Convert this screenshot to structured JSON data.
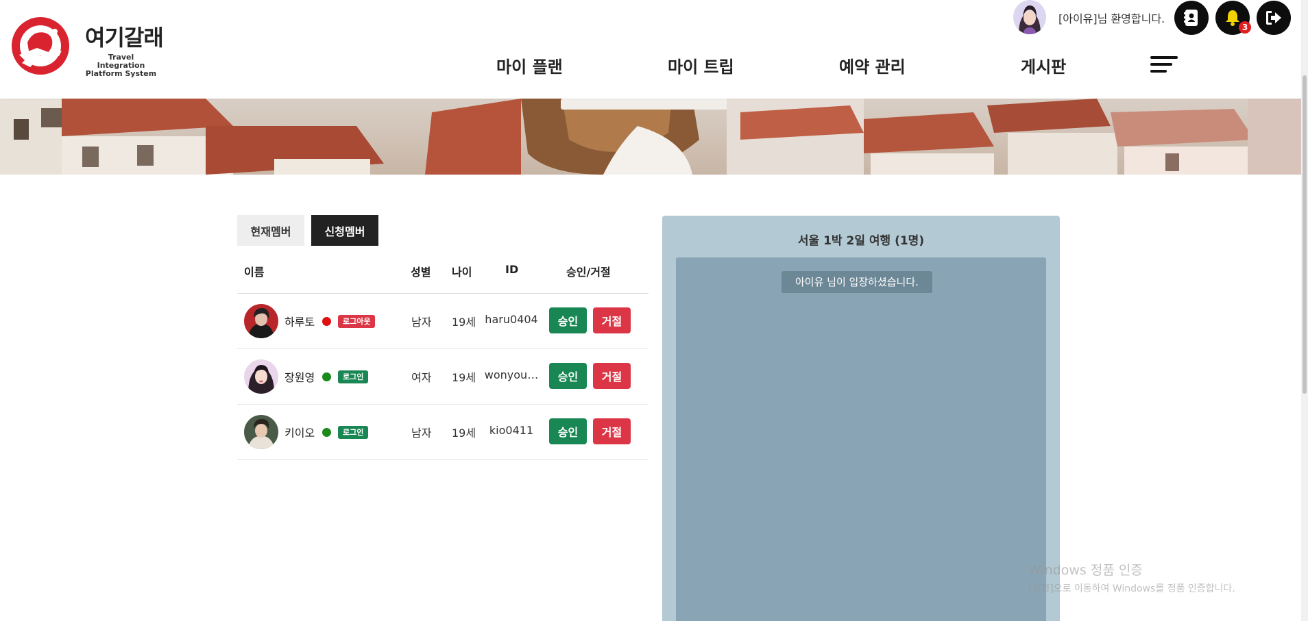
{
  "brand": {
    "name": "여기갈래",
    "subtitle_line1": "Travel Integration",
    "subtitle_line2": "Platform System"
  },
  "nav": {
    "items": [
      {
        "label": "마이 플랜"
      },
      {
        "label": "마이 트립"
      },
      {
        "label": "예약 관리"
      },
      {
        "label": "게시판"
      }
    ]
  },
  "user": {
    "welcome": "[아이유]님 환영합니다.",
    "notification_count": "3"
  },
  "icons": {
    "contacts": "contact-book-icon",
    "notifications": "bell-icon",
    "logout": "logout-icon",
    "menu": "hamburger-menu-icon"
  },
  "tabs": [
    {
      "label": "현재멤버",
      "active": false
    },
    {
      "label": "신청멤버",
      "active": true
    }
  ],
  "table": {
    "headers": {
      "name": "이름",
      "gender": "성별",
      "age": "나이",
      "id": "ID",
      "action": "승인/거절"
    },
    "rows": [
      {
        "name": "하루토",
        "status": "로그아웃",
        "online": false,
        "gender": "남자",
        "age": "19세",
        "id": "haru0404",
        "approve": "승인",
        "reject": "거절"
      },
      {
        "name": "장원영",
        "status": "로그인",
        "online": true,
        "gender": "여자",
        "age": "19세",
        "id": "wonyou…",
        "approve": "승인",
        "reject": "거절"
      },
      {
        "name": "키이오",
        "status": "로그인",
        "online": true,
        "gender": "남자",
        "age": "19세",
        "id": "kio0411",
        "approve": "승인",
        "reject": "거절"
      }
    ]
  },
  "chat": {
    "title": "서울 1박 2일 여행 (1명)",
    "messages": [
      {
        "text": "아이유 님이 입장하셨습니다."
      }
    ]
  },
  "watermark": {
    "title": "Windows 정품 인증",
    "subtitle": "[설정]으로 이동하여 Windows를 정품 인증합니다."
  },
  "colors": {
    "brand_red": "#d9232e",
    "approve_green": "#198754",
    "reject_red": "#dc3545",
    "online_dot": "#1a8a1a",
    "offline_dot": "#e01010",
    "chat_panel": "#b3c9d4",
    "chat_body": "#89a5b5"
  }
}
